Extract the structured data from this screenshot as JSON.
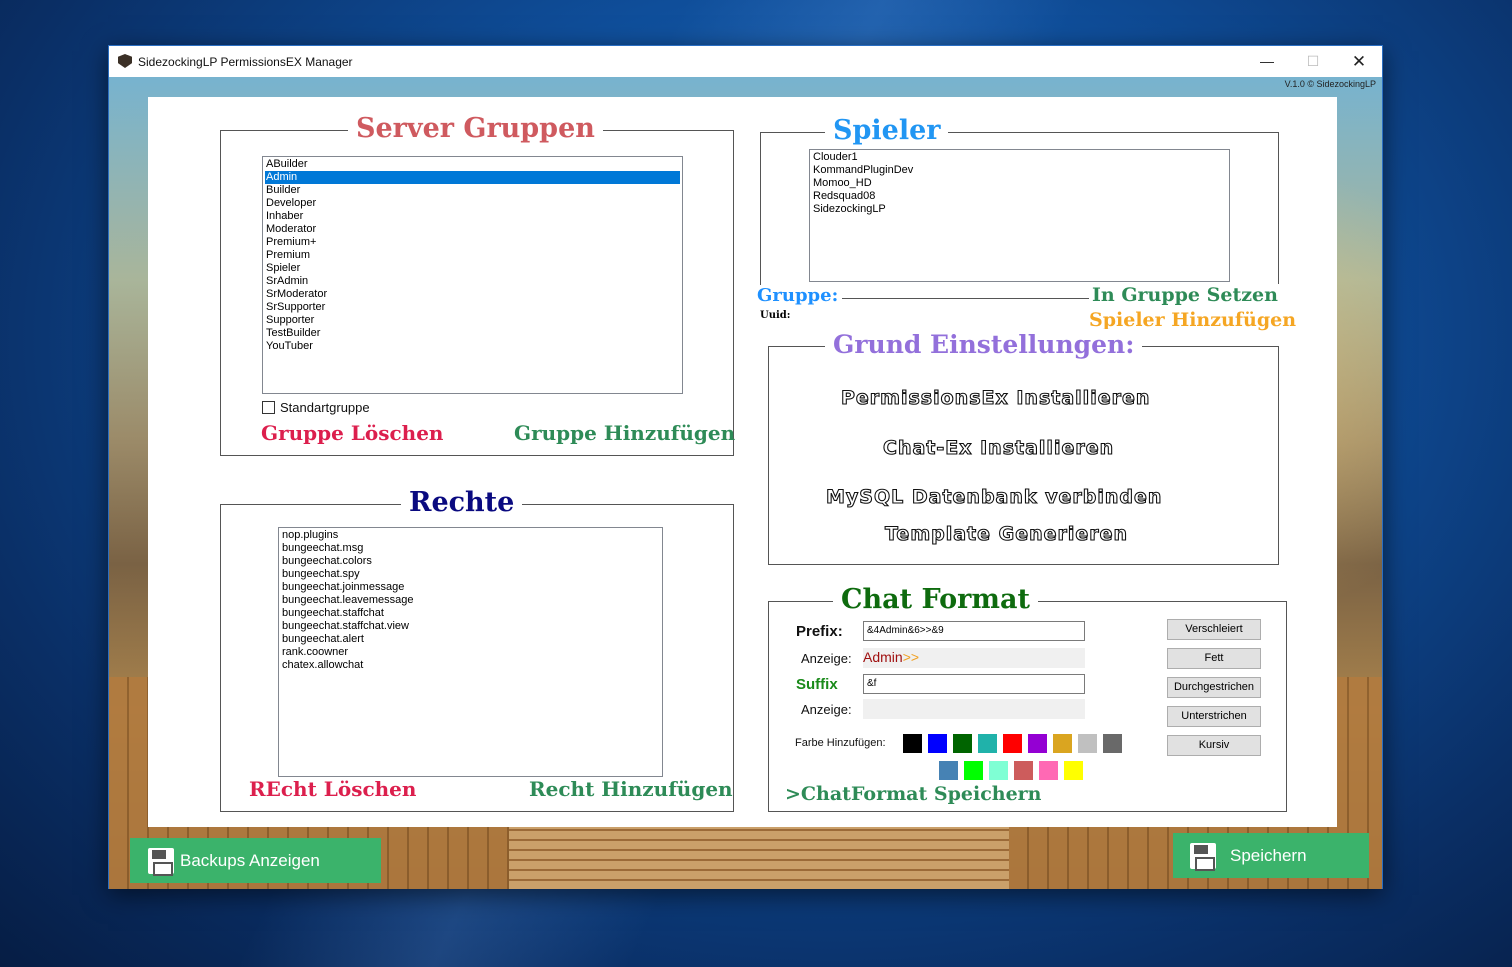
{
  "window": {
    "title": "SidezockingLP PermissionsEX Manager",
    "controls": {
      "minimize": "—",
      "maximize": "☐",
      "close": "✕"
    },
    "version": "V.1.0 © SidezockingLP"
  },
  "server_groups": {
    "title": "Server Gruppen",
    "items": [
      "ABuilder",
      "Admin",
      "Builder",
      "Developer",
      "Inhaber",
      "Moderator",
      "Premium+",
      "Premium",
      "Spieler",
      "SrAdmin",
      "SrModerator",
      "SrSupporter",
      "Supporter",
      "TestBuilder",
      "YouTuber"
    ],
    "selected_index": 1,
    "checkbox_label": "Standartgruppe",
    "checkbox_checked": false,
    "delete_label": "Gruppe Löschen",
    "add_label": "Gruppe Hinzufügen"
  },
  "rights": {
    "title": "Rechte",
    "items": [
      "nop.plugins",
      "bungeechat.msg",
      "bungeechat.colors",
      "bungeechat.spy",
      "bungeechat.joinmessage",
      "bungeechat.leavemessage",
      "bungeechat.staffchat",
      "bungeechat.staffchat.view",
      "bungeechat.alert",
      "rank.coowner",
      "chatex.allowchat"
    ],
    "delete_label": "REcht Löschen",
    "add_label": "Recht Hinzufügen"
  },
  "players": {
    "title": "Spieler",
    "items": [
      "Clouder1",
      "KommandPluginDev",
      "Momoo_HD",
      "Redsquad08",
      "SidezockingLP"
    ],
    "group_label": "Gruppe:",
    "uuid_label": "Uuid:",
    "set_group_label": "In Gruppe Setzen",
    "add_player_label": "Spieler Hinzufügen"
  },
  "basic_settings": {
    "title": "Grund Einstellungen:",
    "actions": [
      "PermissionsEx Installieren",
      "Chat-Ex Installieren",
      "MySQL Datenbank verbinden",
      "Template Generieren"
    ]
  },
  "chat_format": {
    "title": "Chat Format",
    "prefix_label": "Prefix:",
    "prefix_value": "&4Admin&6>>&9",
    "preview_label_1": "Anzeige:",
    "preview_1_red": "Admin",
    "preview_1_gold": ">>",
    "suffix_label": "Suffix",
    "suffix_value": "&f",
    "preview_label_2": "Anzeige:",
    "color_label": "Farbe Hinzufügen:",
    "colors_row1": [
      "#000000",
      "#0000ff",
      "#006400",
      "#20b2aa",
      "#ff0000",
      "#9400d3",
      "#daa520",
      "#c0c0c0",
      "#696969"
    ],
    "colors_row2": [
      "#4682b4",
      "#00ff00",
      "#7fffd4",
      "#cd5c5c",
      "#ff69b4",
      "#ffff00"
    ],
    "style_buttons": [
      "Verschleiert",
      "Fett",
      "Durchgestrichen",
      "Unterstrichen",
      "Kursiv"
    ],
    "save_label": ">ChatFormat Speichern"
  },
  "bottom": {
    "backups_label": "Backups Anzeigen",
    "save_label": "Speichern"
  }
}
